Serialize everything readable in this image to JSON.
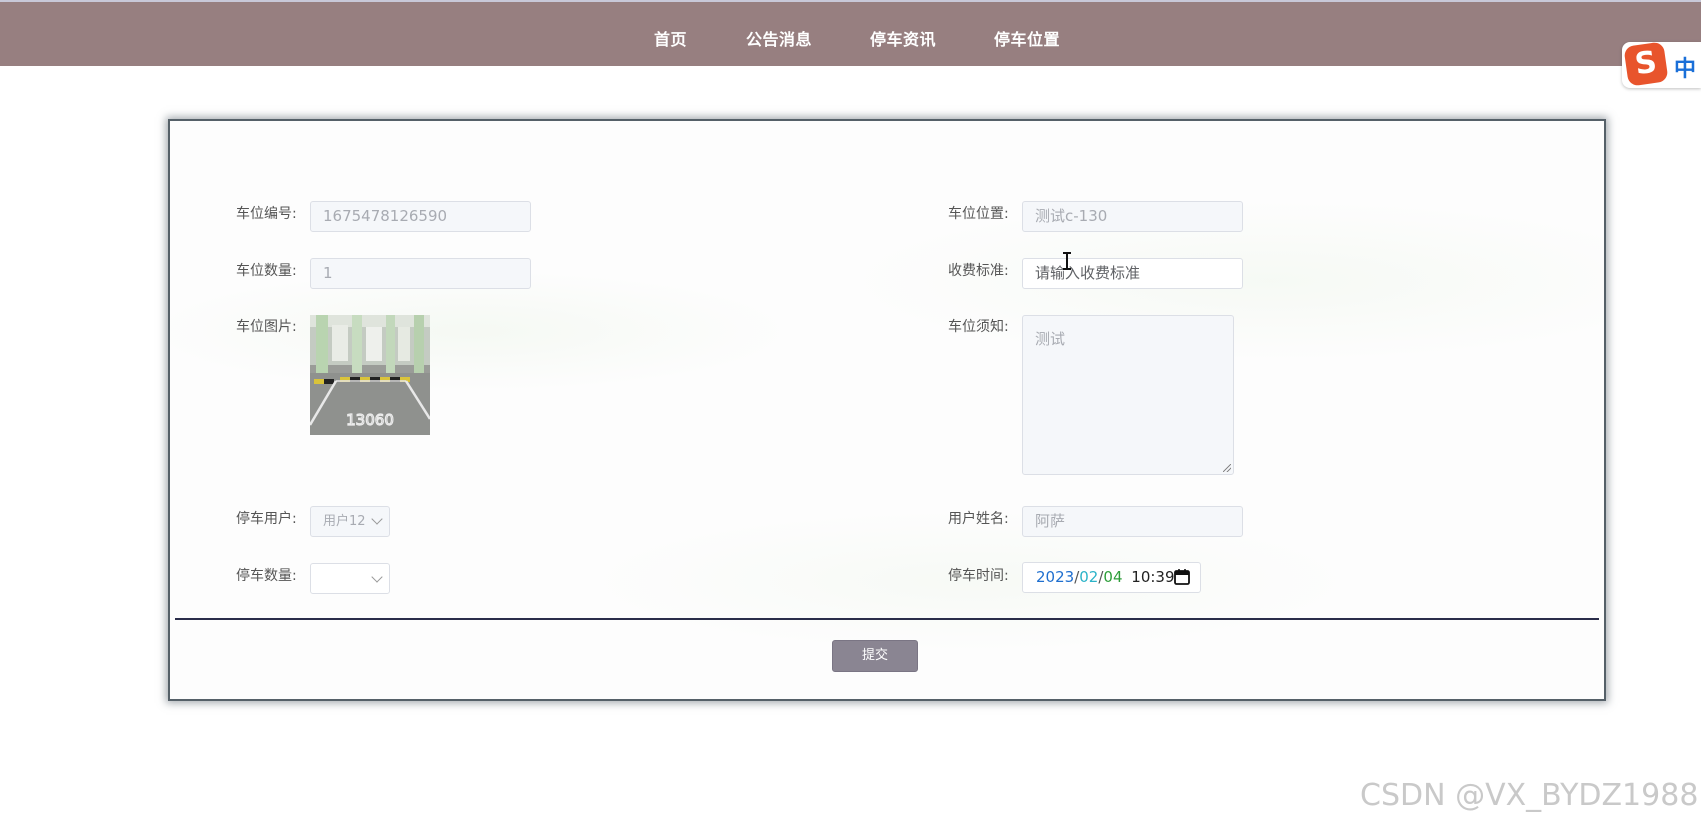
{
  "nav": {
    "items": [
      {
        "label": "首页"
      },
      {
        "label": "公告消息"
      },
      {
        "label": "停车资讯"
      },
      {
        "label": "停车位置"
      }
    ]
  },
  "ime": {
    "label": "中"
  },
  "form": {
    "space_number": {
      "label": "车位编号:",
      "value": "1675478126590"
    },
    "space_location": {
      "label": "车位位置:",
      "value": "测试c-130"
    },
    "space_count": {
      "label": "车位数量:",
      "value": "1"
    },
    "fee_standard": {
      "label": "收费标准:",
      "placeholder": "请输入收费标准"
    },
    "space_image": {
      "label": "车位图片:",
      "image_text": "13060"
    },
    "space_notice": {
      "label": "车位须知:",
      "value": "测试"
    },
    "parking_user": {
      "label": "停车用户:",
      "value": "用户12"
    },
    "user_name": {
      "label": "用户姓名:",
      "value": "阿萨"
    },
    "parking_count": {
      "label": "停车数量:",
      "value": ""
    },
    "parking_time": {
      "label": "停车时间:",
      "year": "2023",
      "sep1": "/",
      "month": "02",
      "sep2": "/",
      "day": "04",
      "time": "10:39"
    },
    "submit_label": "提交"
  },
  "colors": {
    "nav_bg": "#977f80",
    "year": "#1f6fcf",
    "month": "#2bb3c8",
    "day": "#2e9e3a"
  },
  "watermark": "CSDN @VX_BYDZ1988"
}
